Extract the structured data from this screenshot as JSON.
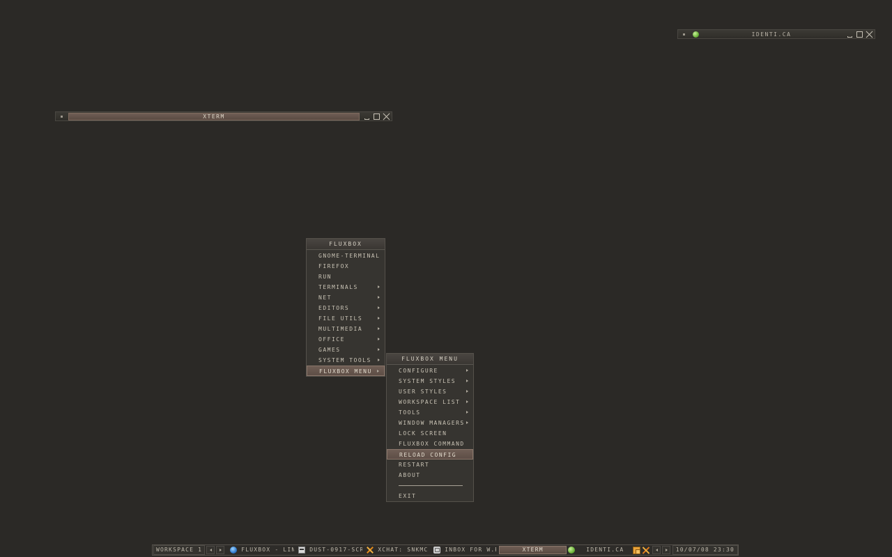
{
  "windows": {
    "identica": {
      "title": "IDENTI.CA"
    },
    "xterm": {
      "title": "XTERM"
    }
  },
  "root_menu": {
    "title": "FLUXBOX",
    "items": [
      {
        "label": "GNOME-TERMINAL",
        "submenu": false
      },
      {
        "label": "FIREFOX",
        "submenu": false
      },
      {
        "label": "RUN",
        "submenu": false
      },
      {
        "label": "TERMINALS",
        "submenu": true
      },
      {
        "label": "NET",
        "submenu": true
      },
      {
        "label": "EDITORS",
        "submenu": true
      },
      {
        "label": "FILE UTILS",
        "submenu": true
      },
      {
        "label": "MULTIMEDIA",
        "submenu": true
      },
      {
        "label": "OFFICE",
        "submenu": true
      },
      {
        "label": "GAMES",
        "submenu": true
      },
      {
        "label": "SYSTEM TOOLS",
        "submenu": true
      },
      {
        "label": "FLUXBOX MENU",
        "submenu": true,
        "highlighted": true
      }
    ]
  },
  "sub_menu": {
    "title": "FLUXBOX MENU",
    "items": [
      {
        "label": "CONFIGURE",
        "submenu": true
      },
      {
        "label": "SYSTEM STYLES",
        "submenu": true
      },
      {
        "label": "USER STYLES",
        "submenu": true
      },
      {
        "label": "WORKSPACE LIST",
        "submenu": true
      },
      {
        "label": "TOOLS",
        "submenu": true
      },
      {
        "label": "WINDOW MANAGERS",
        "submenu": true
      },
      {
        "label": "LOCK SCREEN",
        "submenu": false
      },
      {
        "label": "FLUXBOX COMMAND",
        "submenu": false
      },
      {
        "label": "RELOAD CONFIG",
        "submenu": false,
        "highlighted": true
      },
      {
        "label": "RESTART",
        "submenu": false
      },
      {
        "label": "ABOUT",
        "submenu": false
      },
      {
        "label": "EXIT",
        "submenu": false
      }
    ]
  },
  "toolbar": {
    "workspace": "WORKSPACE 1",
    "tasks": [
      {
        "label": "FLUXBOX - LIN",
        "icon": "globe-icon"
      },
      {
        "label": "DUST-0917-SCR",
        "icon": "document-icon"
      },
      {
        "label": "XCHAT: SNKMC",
        "icon": "xchat-icon"
      },
      {
        "label": "INBOX FOR W.R",
        "icon": "mail-icon"
      },
      {
        "label": "XTERM",
        "icon": "",
        "active": true
      },
      {
        "label": "IDENTI.CA",
        "icon": "green-dot-icon"
      }
    ],
    "clock": "10/07/08 23:30"
  },
  "colors": {
    "desktop": "#2b2926",
    "highlight": "#6f5e55",
    "text": "#c8c2b4"
  }
}
